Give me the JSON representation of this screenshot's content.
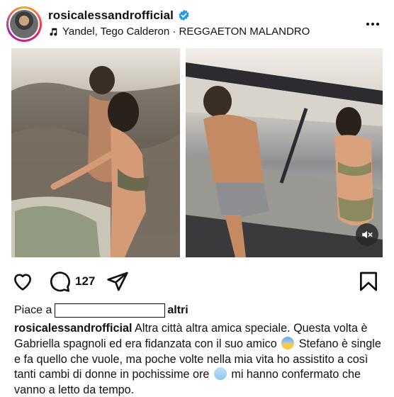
{
  "post": {
    "username": "rosicalessandrofficial",
    "music": "Yandel, Tego Calderon · REGGAETON MALANDRO",
    "comment_count": "127",
    "likes_prefix": "Piace a",
    "likes_suffix": "altri",
    "caption_user": "rosicalessandrofficial",
    "caption_part1": " Altra città altra amica speciale. Questa volta è Gabriella spagnoli ed era fidanzata con il suo amico ",
    "caption_part2": " Stefano è single e fa quello che vuole, ma poche volte nella mia vita ho assistito a così tanti cambi di donne in pochissime ore ",
    "caption_part3": " mi hanno confermato che vanno a letto da tempo."
  },
  "icons": {
    "verified": "verified-badge-icon",
    "music": "music-note-icon",
    "more": "more-horizontal-icon",
    "like": "heart-icon",
    "comment": "comment-bubble-icon",
    "share": "paper-plane-icon",
    "save": "bookmark-icon",
    "mute": "muted-speaker-icon",
    "emoji1": "fearful-face-emoji",
    "emoji2": "cold-face-emoji"
  },
  "colors": {
    "verified": "#1d9bf0",
    "text": "#111111",
    "background": "#ffffff"
  }
}
